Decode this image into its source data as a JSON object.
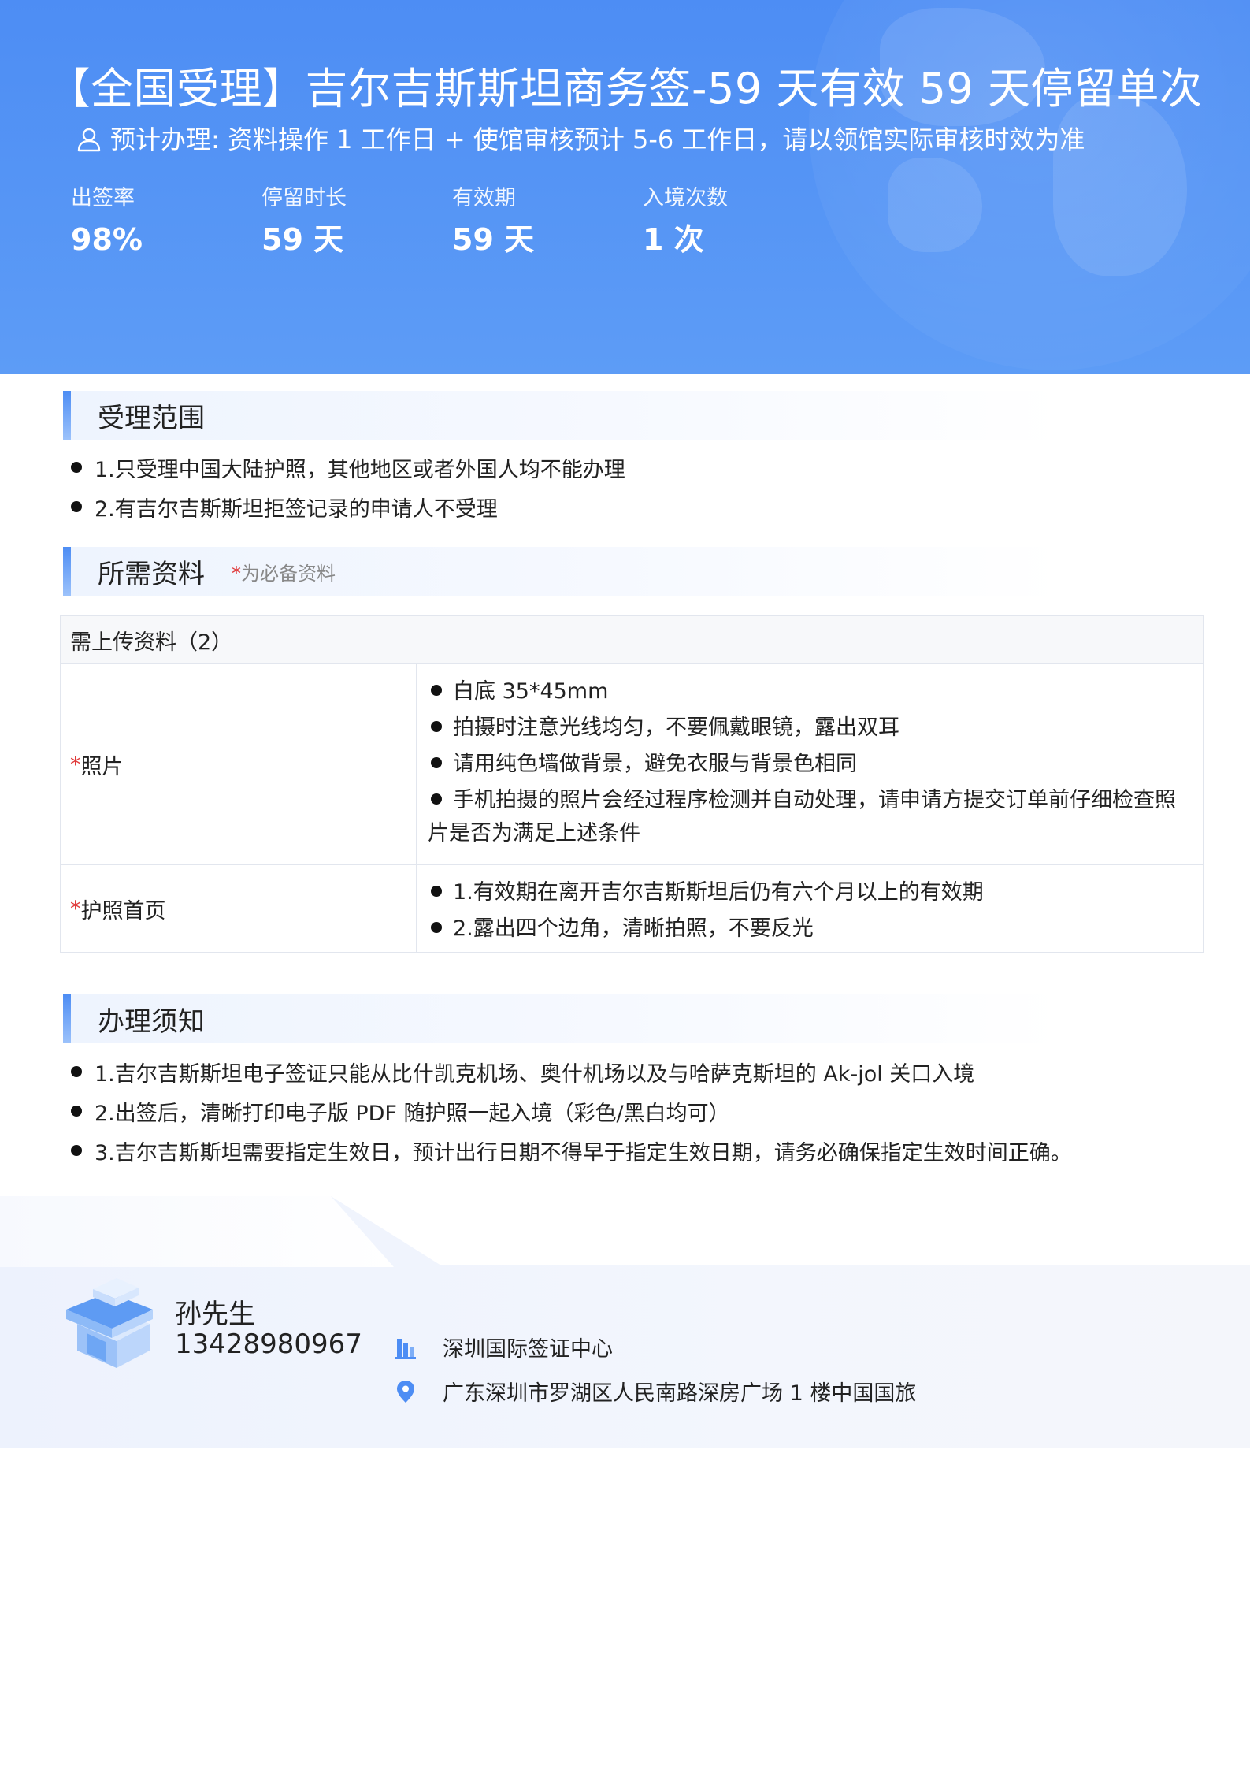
{
  "header": {
    "title": "【全国受理】吉尔吉斯斯坦商务签-59 天有效 59 天停留单次",
    "subtitle": "预计办理: 资料操作 1 工作日 + 使馆审核预计 5-6 工作日，请以领馆实际审核时效为准",
    "stats": [
      {
        "label": "出签率",
        "value": "98%"
      },
      {
        "label": "停留时长",
        "value": "59 天"
      },
      {
        "label": "有效期",
        "value": "59 天"
      },
      {
        "label": "入境次数",
        "value": "1 次"
      }
    ]
  },
  "scope": {
    "title": "受理范围",
    "items": [
      "1.只受理中国大陆护照，其他地区或者外国人均不能办理",
      "2.有吉尔吉斯斯坦拒签记录的申请人不受理"
    ]
  },
  "materials": {
    "title": "所需资料",
    "note_mark": "*",
    "note": "为必备资料",
    "table_header": "需上传资料（2）",
    "rows": [
      {
        "mark": "*",
        "name": "照片",
        "items": [
          "白底 35*45mm",
          "拍摄时注意光线均匀，不要佩戴眼镜，露出双耳",
          "请用纯色墙做背景，避免衣服与背景色相同",
          "手机拍摄的照片会经过程序检测并自动处理，请申请方提交订单前仔细检查照片是否为满足上述条件"
        ]
      },
      {
        "mark": "*",
        "name": "护照首页",
        "items": [
          "1.有效期在离开吉尔吉斯斯坦后仍有六个月以上的有效期",
          "2.露出四个边角，清晰拍照，不要反光"
        ]
      }
    ]
  },
  "notice": {
    "title": "办理须知",
    "items": [
      "1.吉尔吉斯斯坦电子签证只能从比什凯克机场、奥什机场以及与哈萨克斯坦的 Ak-jol 关口入境",
      "2.出签后，清晰打印电子版 PDF 随护照一起入境（彩色/黑白均可）",
      "3.吉尔吉斯斯坦需要指定生效日，预计出行日期不得早于指定生效日期，请务必确保指定生效时间正确。"
    ]
  },
  "contact": {
    "name": "孙先生",
    "phone": "13428980967",
    "company": "深圳国际签证中心",
    "address": "广东深圳市罗湖区人民南路深房广场 1 楼中国国旅",
    "icons": {
      "store": "store-icon",
      "building": "building-icon",
      "location": "location-pin-icon"
    }
  },
  "colors": {
    "accent": "#4d8df4",
    "required": "#e03a3a"
  }
}
